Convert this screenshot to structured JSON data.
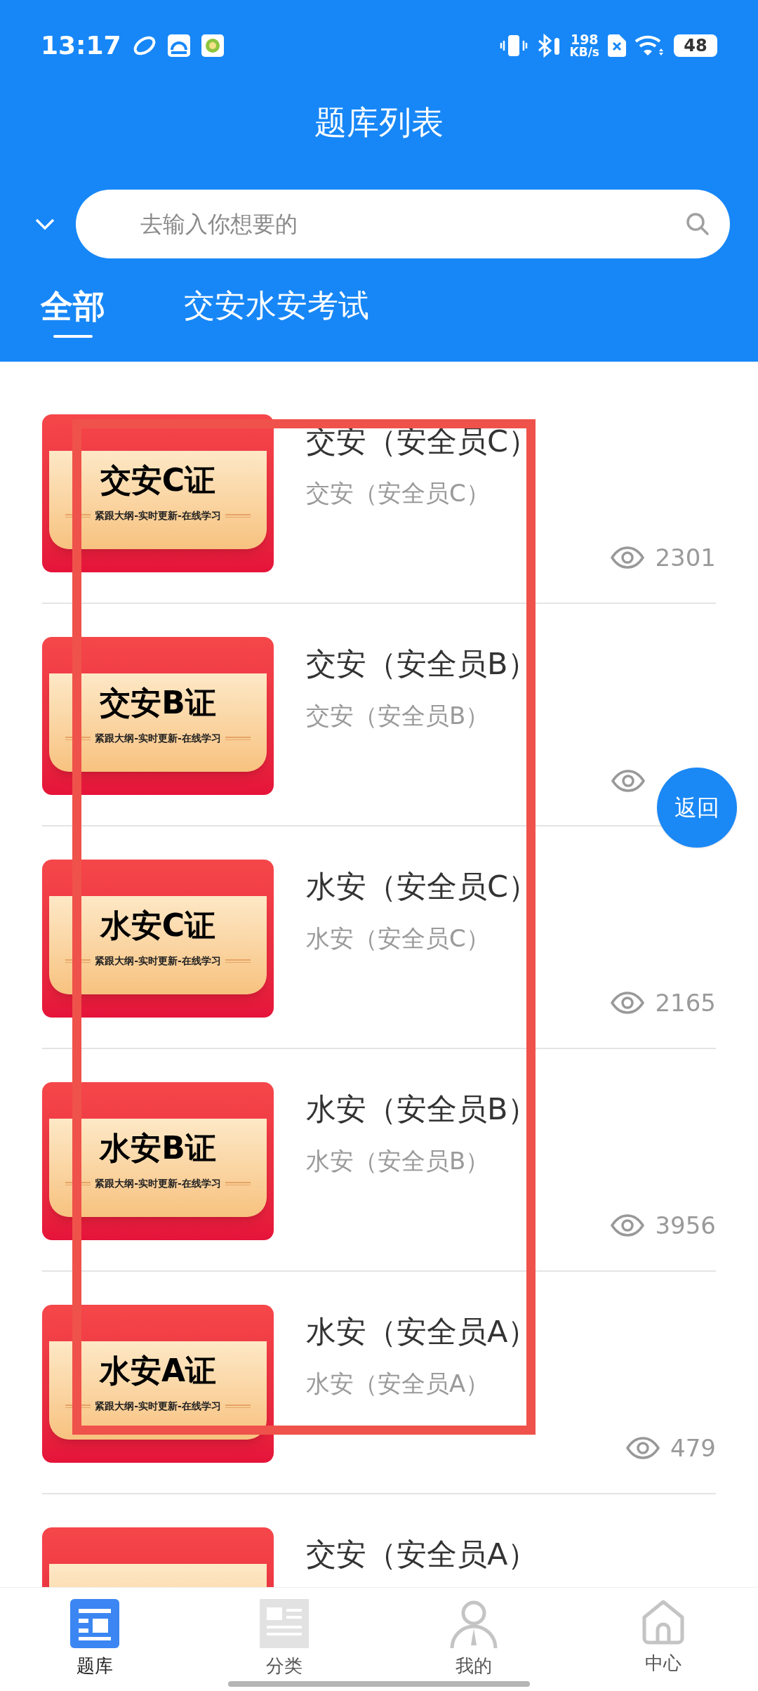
{
  "status_bar": {
    "time": "13:17",
    "net_speed": "198",
    "net_unit": "KB/s",
    "battery": "48"
  },
  "header": {
    "title": "题库列表",
    "search": {
      "placeholder": "去输入你想要的"
    }
  },
  "tabs": [
    {
      "label": "全部",
      "selected": true
    },
    {
      "label": "交安水安考试",
      "selected": false
    }
  ],
  "items": [
    {
      "title": "交安（安全员C）",
      "subtitle": "交安（安全员C）",
      "views": "2301",
      "banner": {
        "heading": "交安C证",
        "tagline": "紧跟大纲-实时更新-在线学习"
      }
    },
    {
      "title": "交安（安全员B）",
      "subtitle": "交安（安全员B）",
      "banner": {
        "heading": "交安B证",
        "tagline": "紧跟大纲-实时更新-在线学习"
      }
    },
    {
      "title": "水安（安全员C）",
      "subtitle": "水安（安全员C）",
      "views": "2165",
      "banner": {
        "heading": "水安C证",
        "tagline": "紧跟大纲-实时更新-在线学习"
      }
    },
    {
      "title": "水安（安全员B）",
      "subtitle": "水安（安全员B）",
      "views": "3956",
      "banner": {
        "heading": "水安B证",
        "tagline": "紧跟大纲-实时更新-在线学习"
      }
    },
    {
      "title": "水安（安全员A）",
      "subtitle": "水安（安全员A）",
      "views": "479",
      "banner": {
        "heading": "水安A证",
        "tagline": "紧跟大纲-实时更新-在线学习"
      }
    },
    {
      "title": "交安（安全员A）"
    }
  ],
  "return_button": "返回",
  "bottom_nav": [
    {
      "label": "题库",
      "kind": "list",
      "selected": true
    },
    {
      "label": "分类",
      "kind": "document",
      "selected": false
    },
    {
      "label": "我的",
      "kind": "person",
      "selected": false
    },
    {
      "label": "中心",
      "kind": "home",
      "selected": false
    }
  ]
}
